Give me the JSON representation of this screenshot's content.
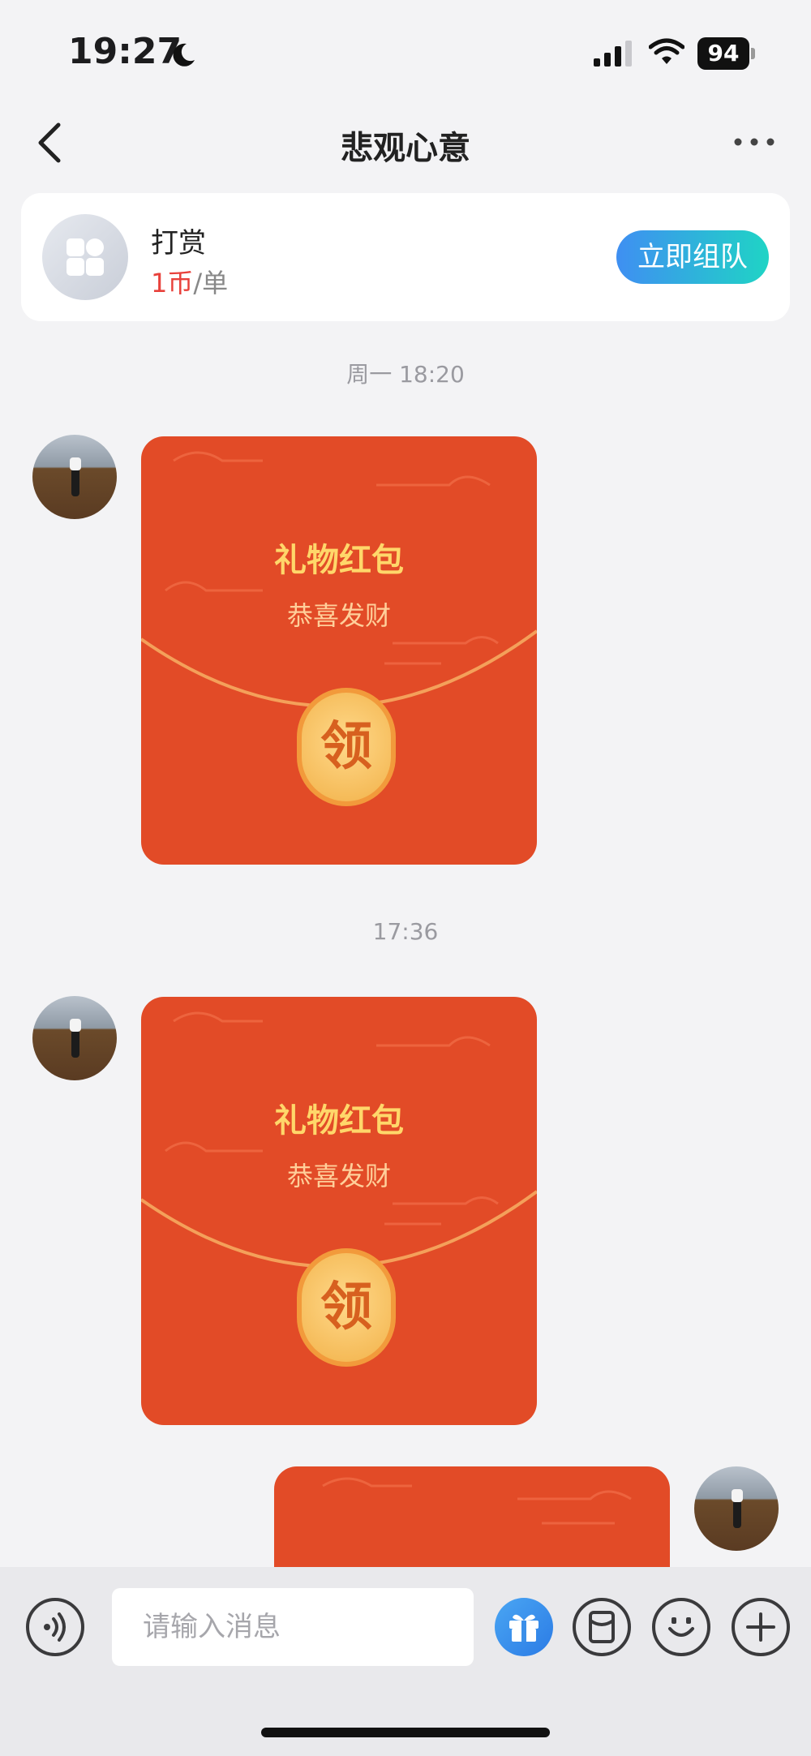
{
  "status": {
    "time": "19:27",
    "battery": "94"
  },
  "nav": {
    "title": "悲观心意"
  },
  "card": {
    "title": "打赏",
    "price_value": "1币",
    "price_unit": "/单",
    "button": "立即组队"
  },
  "messages": [
    {
      "timestamp": "周一 18:20",
      "packet_title": "礼物红包",
      "packet_sub": "恭喜发财",
      "claim": "领"
    },
    {
      "timestamp": "17:36",
      "packet_title": "礼物红包",
      "packet_sub": "恭喜发财",
      "claim": "领"
    }
  ],
  "input": {
    "placeholder": "请输入消息"
  },
  "icons": {
    "status": [
      "moon-icon",
      "signal-icon",
      "wifi-icon",
      "battery-icon"
    ],
    "nav": [
      "back-icon",
      "more-icon"
    ],
    "toolbar": [
      "voice-icon",
      "gift-icon",
      "red-packet-icon",
      "emoji-icon",
      "plus-icon"
    ]
  },
  "colors": {
    "accent_red": "#e24b27",
    "gold": "#ffd76a",
    "team_button_start": "#3f8ff2",
    "team_button_end": "#1fd4c5"
  }
}
